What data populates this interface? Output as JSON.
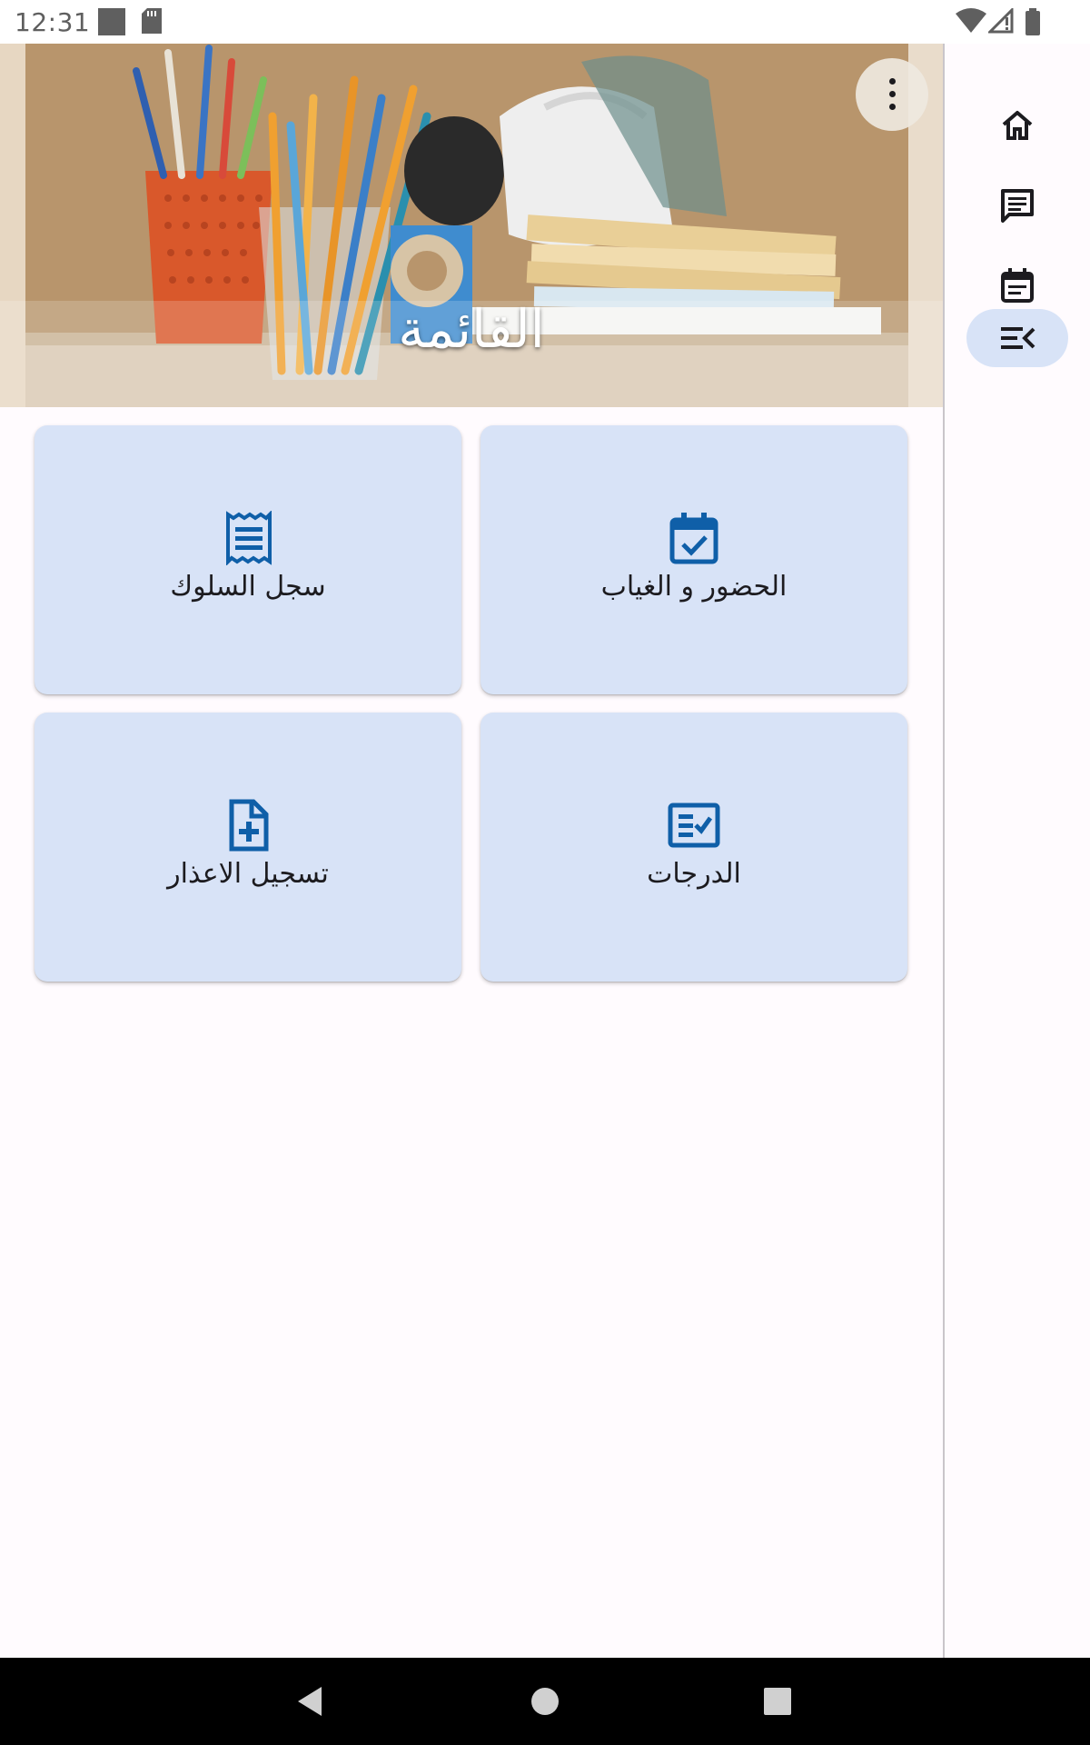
{
  "status_bar": {
    "time": "12:31",
    "icons": [
      "image-notification-icon",
      "sd-card-icon",
      "wifi-icon",
      "cell-signal-icon",
      "battery-icon"
    ]
  },
  "header": {
    "title": "القائمة",
    "more_icon": "more-vert-icon"
  },
  "menu_cards": [
    {
      "label": "الحضور و الغياب",
      "icon": "calendar-check-icon"
    },
    {
      "label": "سجل السلوك",
      "icon": "receipt-icon"
    },
    {
      "label": "الدرجات",
      "icon": "grading-checklist-icon"
    },
    {
      "label": "تسجيل الاعذار",
      "icon": "note-add-icon"
    }
  ],
  "rail": {
    "items": [
      {
        "icon": "home-icon",
        "active": false
      },
      {
        "icon": "message-icon",
        "active": false
      },
      {
        "icon": "event-note-icon",
        "active": false
      },
      {
        "icon": "menu-open-icon",
        "active": true
      }
    ]
  },
  "nav_bar": {
    "buttons": [
      "back-icon",
      "home-circle-icon",
      "recents-icon"
    ]
  },
  "colors": {
    "card_bg": "#d8e3f7",
    "icon_blue": "#0f5fa8",
    "rail_active": "#d8e3f7"
  }
}
